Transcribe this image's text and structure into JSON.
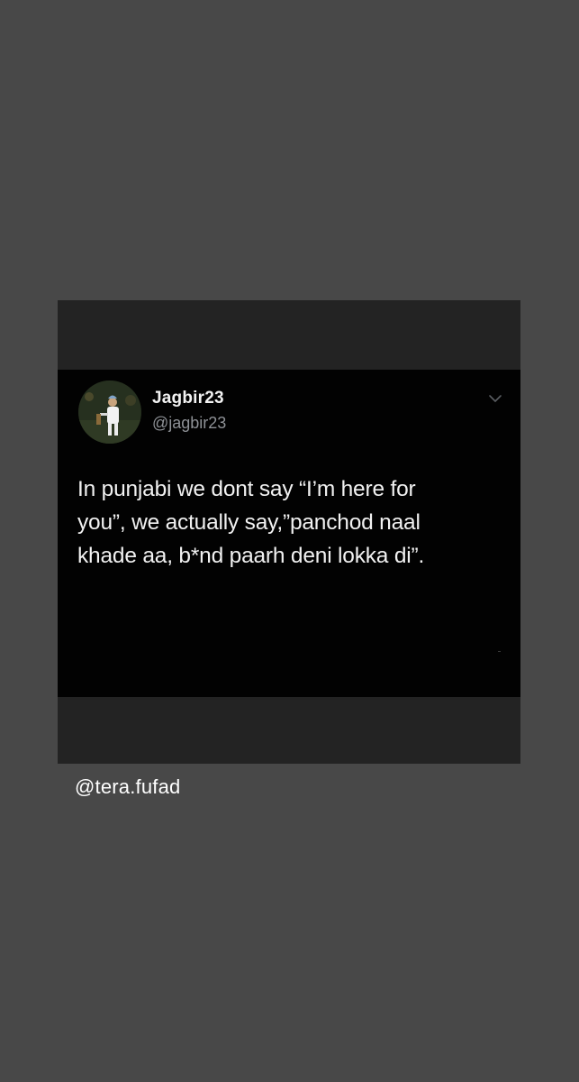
{
  "tweet": {
    "display_name": "Jagbir23",
    "handle": "@jagbir23",
    "text": "In punjabi we dont say “I’m here for\nyou”, we actually say,”panchod naal\nkhade aa, b*nd paarh deni lokka di”.",
    "menu_icon": "chevron-down-icon",
    "avatar_icon": "profile-photo"
  },
  "watermark": {
    "text": "@tera.fufad"
  },
  "colors": {
    "page_background": "#484848",
    "frame_background": "#232323",
    "tweet_background": "#020202",
    "name_color": "#f2f2f2",
    "handle_color": "#8e9196",
    "text_color": "#f1f1f1"
  }
}
